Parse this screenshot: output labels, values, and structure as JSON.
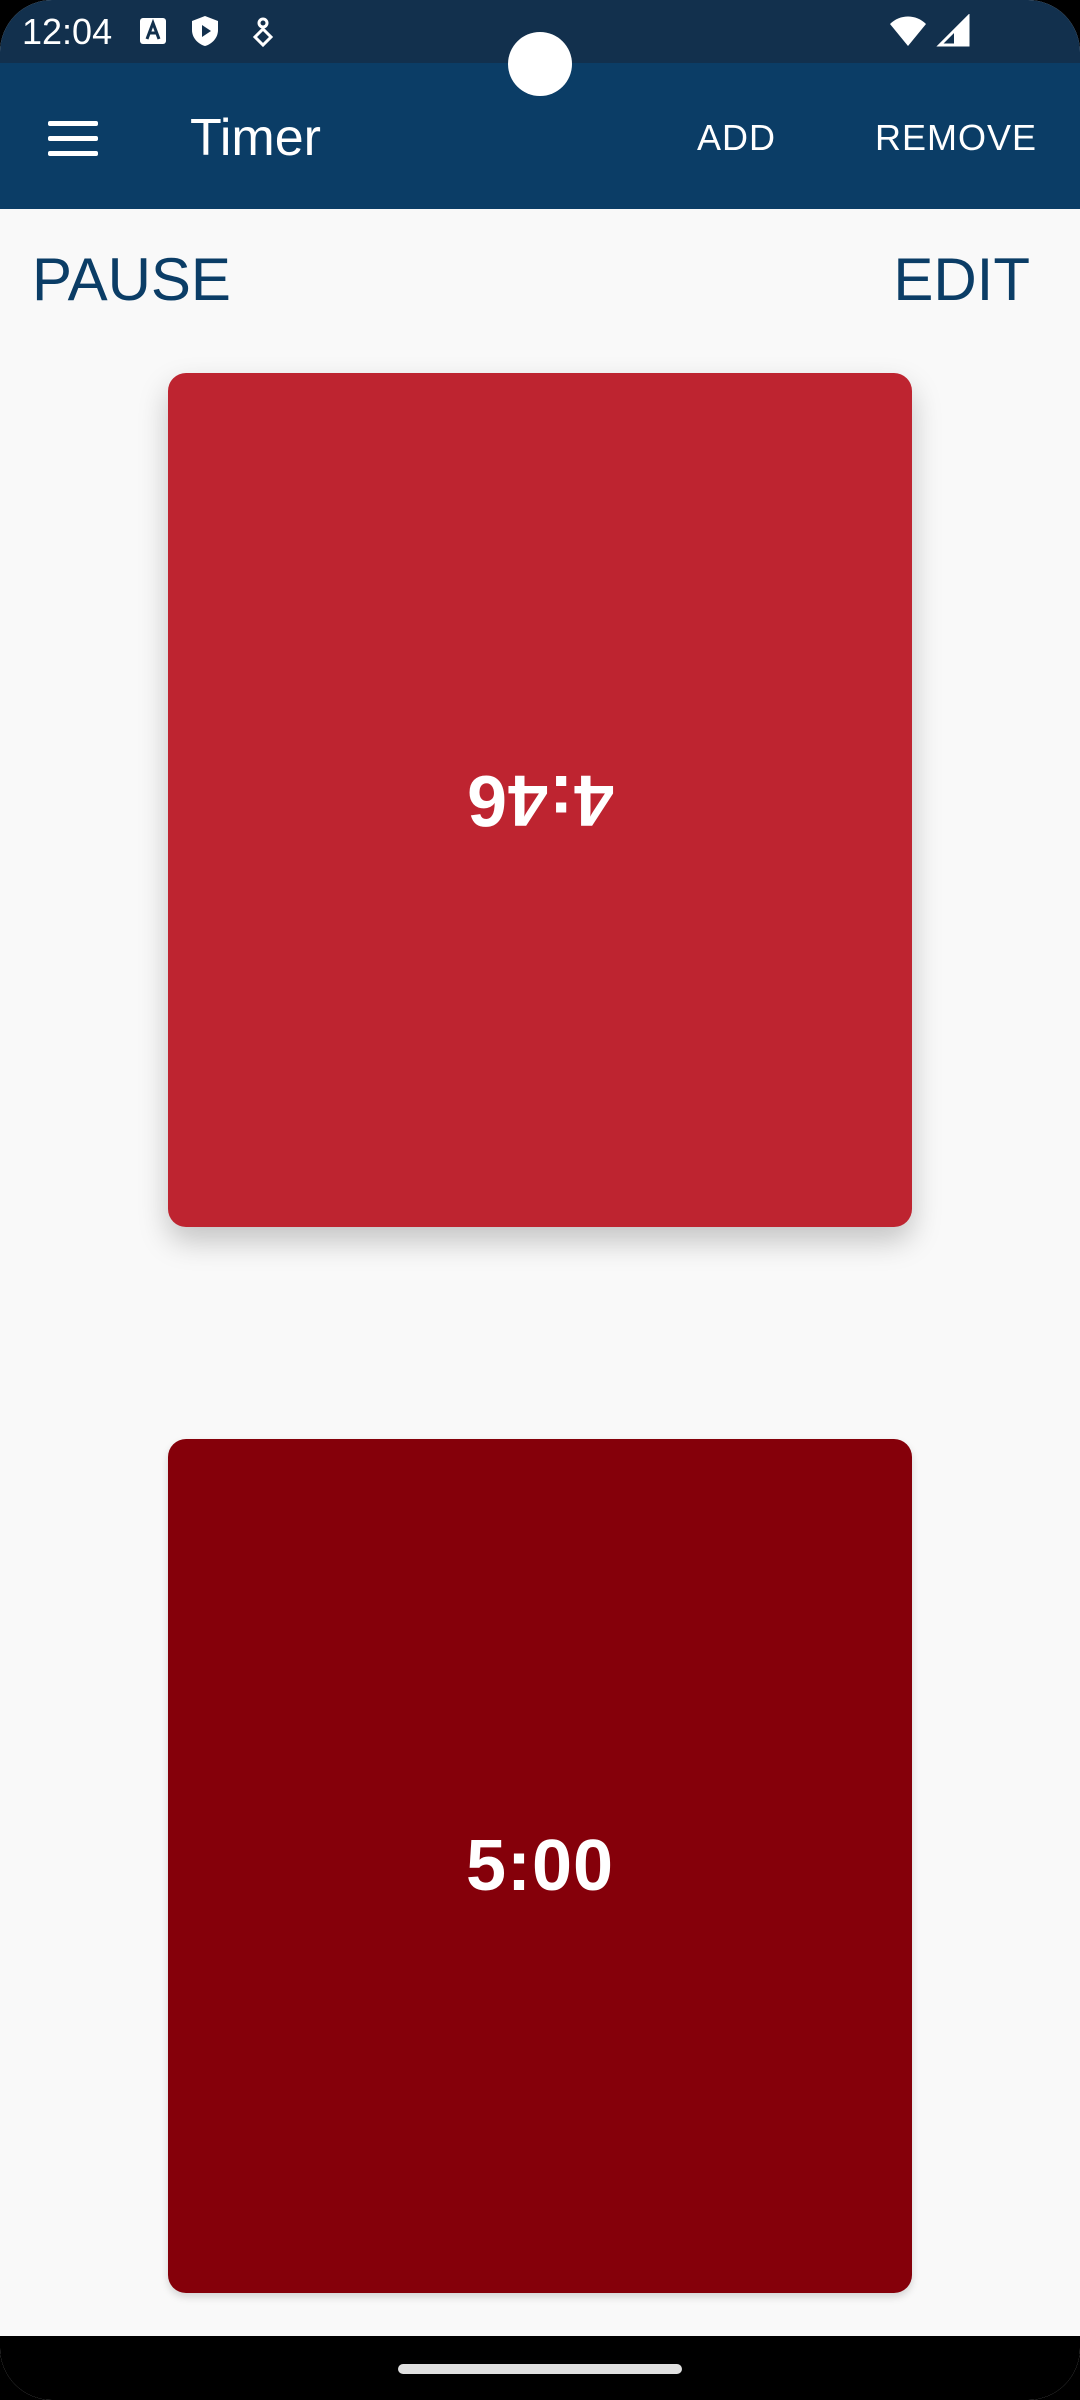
{
  "status_bar": {
    "time": "12:04",
    "icons": [
      "font-a-icon",
      "shield-play-icon",
      "debug-bug-icon",
      "wifi-icon",
      "cellular-signal-icon"
    ]
  },
  "app_bar": {
    "title": "Timer",
    "add_label": "ADD",
    "remove_label": "REMOVE"
  },
  "controls": {
    "pause_label": "PAUSE",
    "edit_label": "EDIT"
  },
  "timers": [
    {
      "value": "4:46",
      "color": "#be2430",
      "orientation": "upside-down"
    },
    {
      "value": "5:00",
      "color": "#85000a",
      "orientation": "upright"
    }
  ],
  "colors": {
    "status_bar": "#12304d",
    "app_bar": "#0b3d66",
    "accent_text": "#0b3d66",
    "background": "#f9f9f9"
  }
}
